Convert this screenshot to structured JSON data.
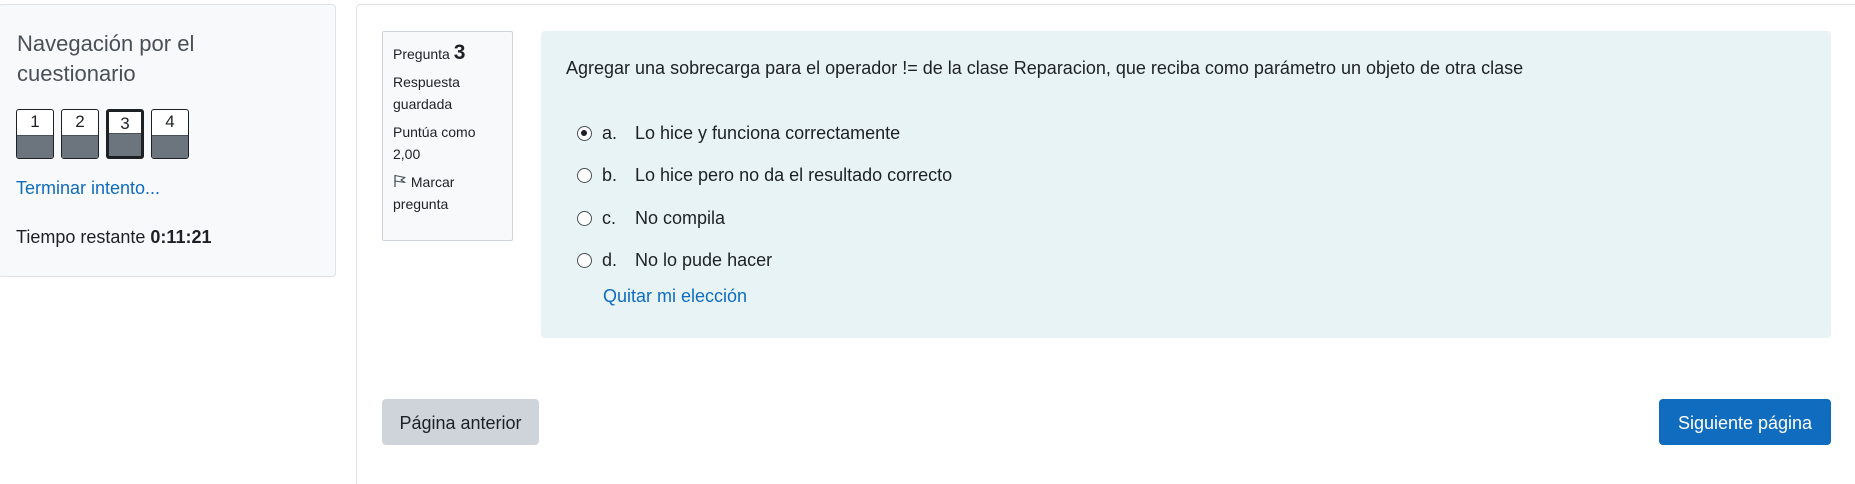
{
  "nav": {
    "title": "Navegación por el cuestionario",
    "questions": [
      {
        "label": "1",
        "status": "answered",
        "current": false
      },
      {
        "label": "2",
        "status": "answered",
        "current": false
      },
      {
        "label": "3",
        "status": "answered",
        "current": true
      },
      {
        "label": "4",
        "status": "answered",
        "current": false
      }
    ],
    "finish_link": "Terminar intento...",
    "timer_label": "Tiempo restante",
    "timer_value": "0:11:21"
  },
  "question_info": {
    "number_label": "Pregunta",
    "number": "3",
    "state": "Respuesta guardada",
    "grade": "Puntúa como 2,00",
    "flag_label": "Marcar pregunta",
    "flag_icon": "flag-icon"
  },
  "question": {
    "text": "Agregar una sobrecarga para el operador != de la clase Reparacion, que reciba como parámetro un objeto de otra clase",
    "answers": [
      {
        "letter": "a.",
        "text": "Lo hice y funciona correctamente",
        "selected": true
      },
      {
        "letter": "b.",
        "text": "Lo hice pero no da el resultado correcto",
        "selected": false
      },
      {
        "letter": "c.",
        "text": "No compila",
        "selected": false
      },
      {
        "letter": "d.",
        "text": "No lo pude hacer",
        "selected": false
      }
    ],
    "clear_choice": "Quitar mi elección"
  },
  "navigation_buttons": {
    "previous": "Página anterior",
    "next": "Siguiente página"
  },
  "colors": {
    "link": "#0f6cbf",
    "primary_button": "#0f6cbf",
    "secondary_button": "#ced4da",
    "formulation_bg": "#e7f3f5",
    "answered_fill": "#6c757d"
  }
}
